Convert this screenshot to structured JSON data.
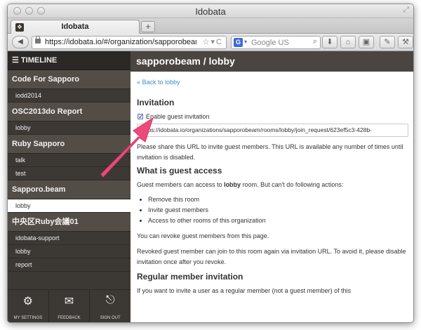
{
  "window": {
    "title": "Idobata"
  },
  "tab": {
    "title": "Idobata",
    "new_tab": "+"
  },
  "navbar": {
    "url": "https://idobata.io/#/organization/sapporobeam/r",
    "search_engine": "G",
    "search_placeholder": "Google US"
  },
  "sidebar": {
    "timeline_label": "TIMELINE",
    "groups": [
      {
        "name": "Code For Sapporo",
        "rooms": [
          "iodd2014"
        ]
      },
      {
        "name": "OSC2013do Report",
        "rooms": [
          "lobby"
        ]
      },
      {
        "name": "Ruby Sapporo",
        "rooms": [
          "talk",
          "test"
        ]
      },
      {
        "name": "Sapporo.beam",
        "rooms": [
          "lobby"
        ]
      },
      {
        "name": "中央区Ruby会議01",
        "rooms": [
          "idobata-support",
          "lobby",
          "report"
        ]
      }
    ],
    "bottom": {
      "settings": "MY SETTINGS",
      "feedback": "FEEDBACK",
      "signout": "SIGN OUT"
    }
  },
  "main": {
    "header": "sapporobeam / lobby",
    "back_link": "« Back to lobby",
    "invitation_heading": "Invitation",
    "checkbox_label": "Enable guest invitation",
    "invite_url": "https://idobata.io/organizations/sapporobeam/rooms/lobby/join_request/623ef5c3-428b-",
    "share_text": "Please share this URL to invite guest members. This URL is available any number of times until invitation is disabled.",
    "guest_heading": "What is guest access",
    "guest_text_pre": "Guest members can access to ",
    "guest_text_bold": "lobby",
    "guest_text_post": " room. But can't do following actions:",
    "actions": [
      "Remove this room",
      "Invite guest members",
      "Access to other rooms of this organization"
    ],
    "revoke_text": "You can revoke guest members from this page.",
    "revoked_text": "Revoked guest member can join to this room again via invitation URL. To avoid it, please disable invitation once after you revoke.",
    "regular_heading": "Regular member invitation",
    "regular_text": "If you want to invite a user as a regular member (not a guest member) of this"
  },
  "colors": {
    "sidebar_bg": "#3c3935",
    "header_bg": "#4a4541",
    "link": "#3b8fc4",
    "arrow": "#ec4a7b"
  }
}
